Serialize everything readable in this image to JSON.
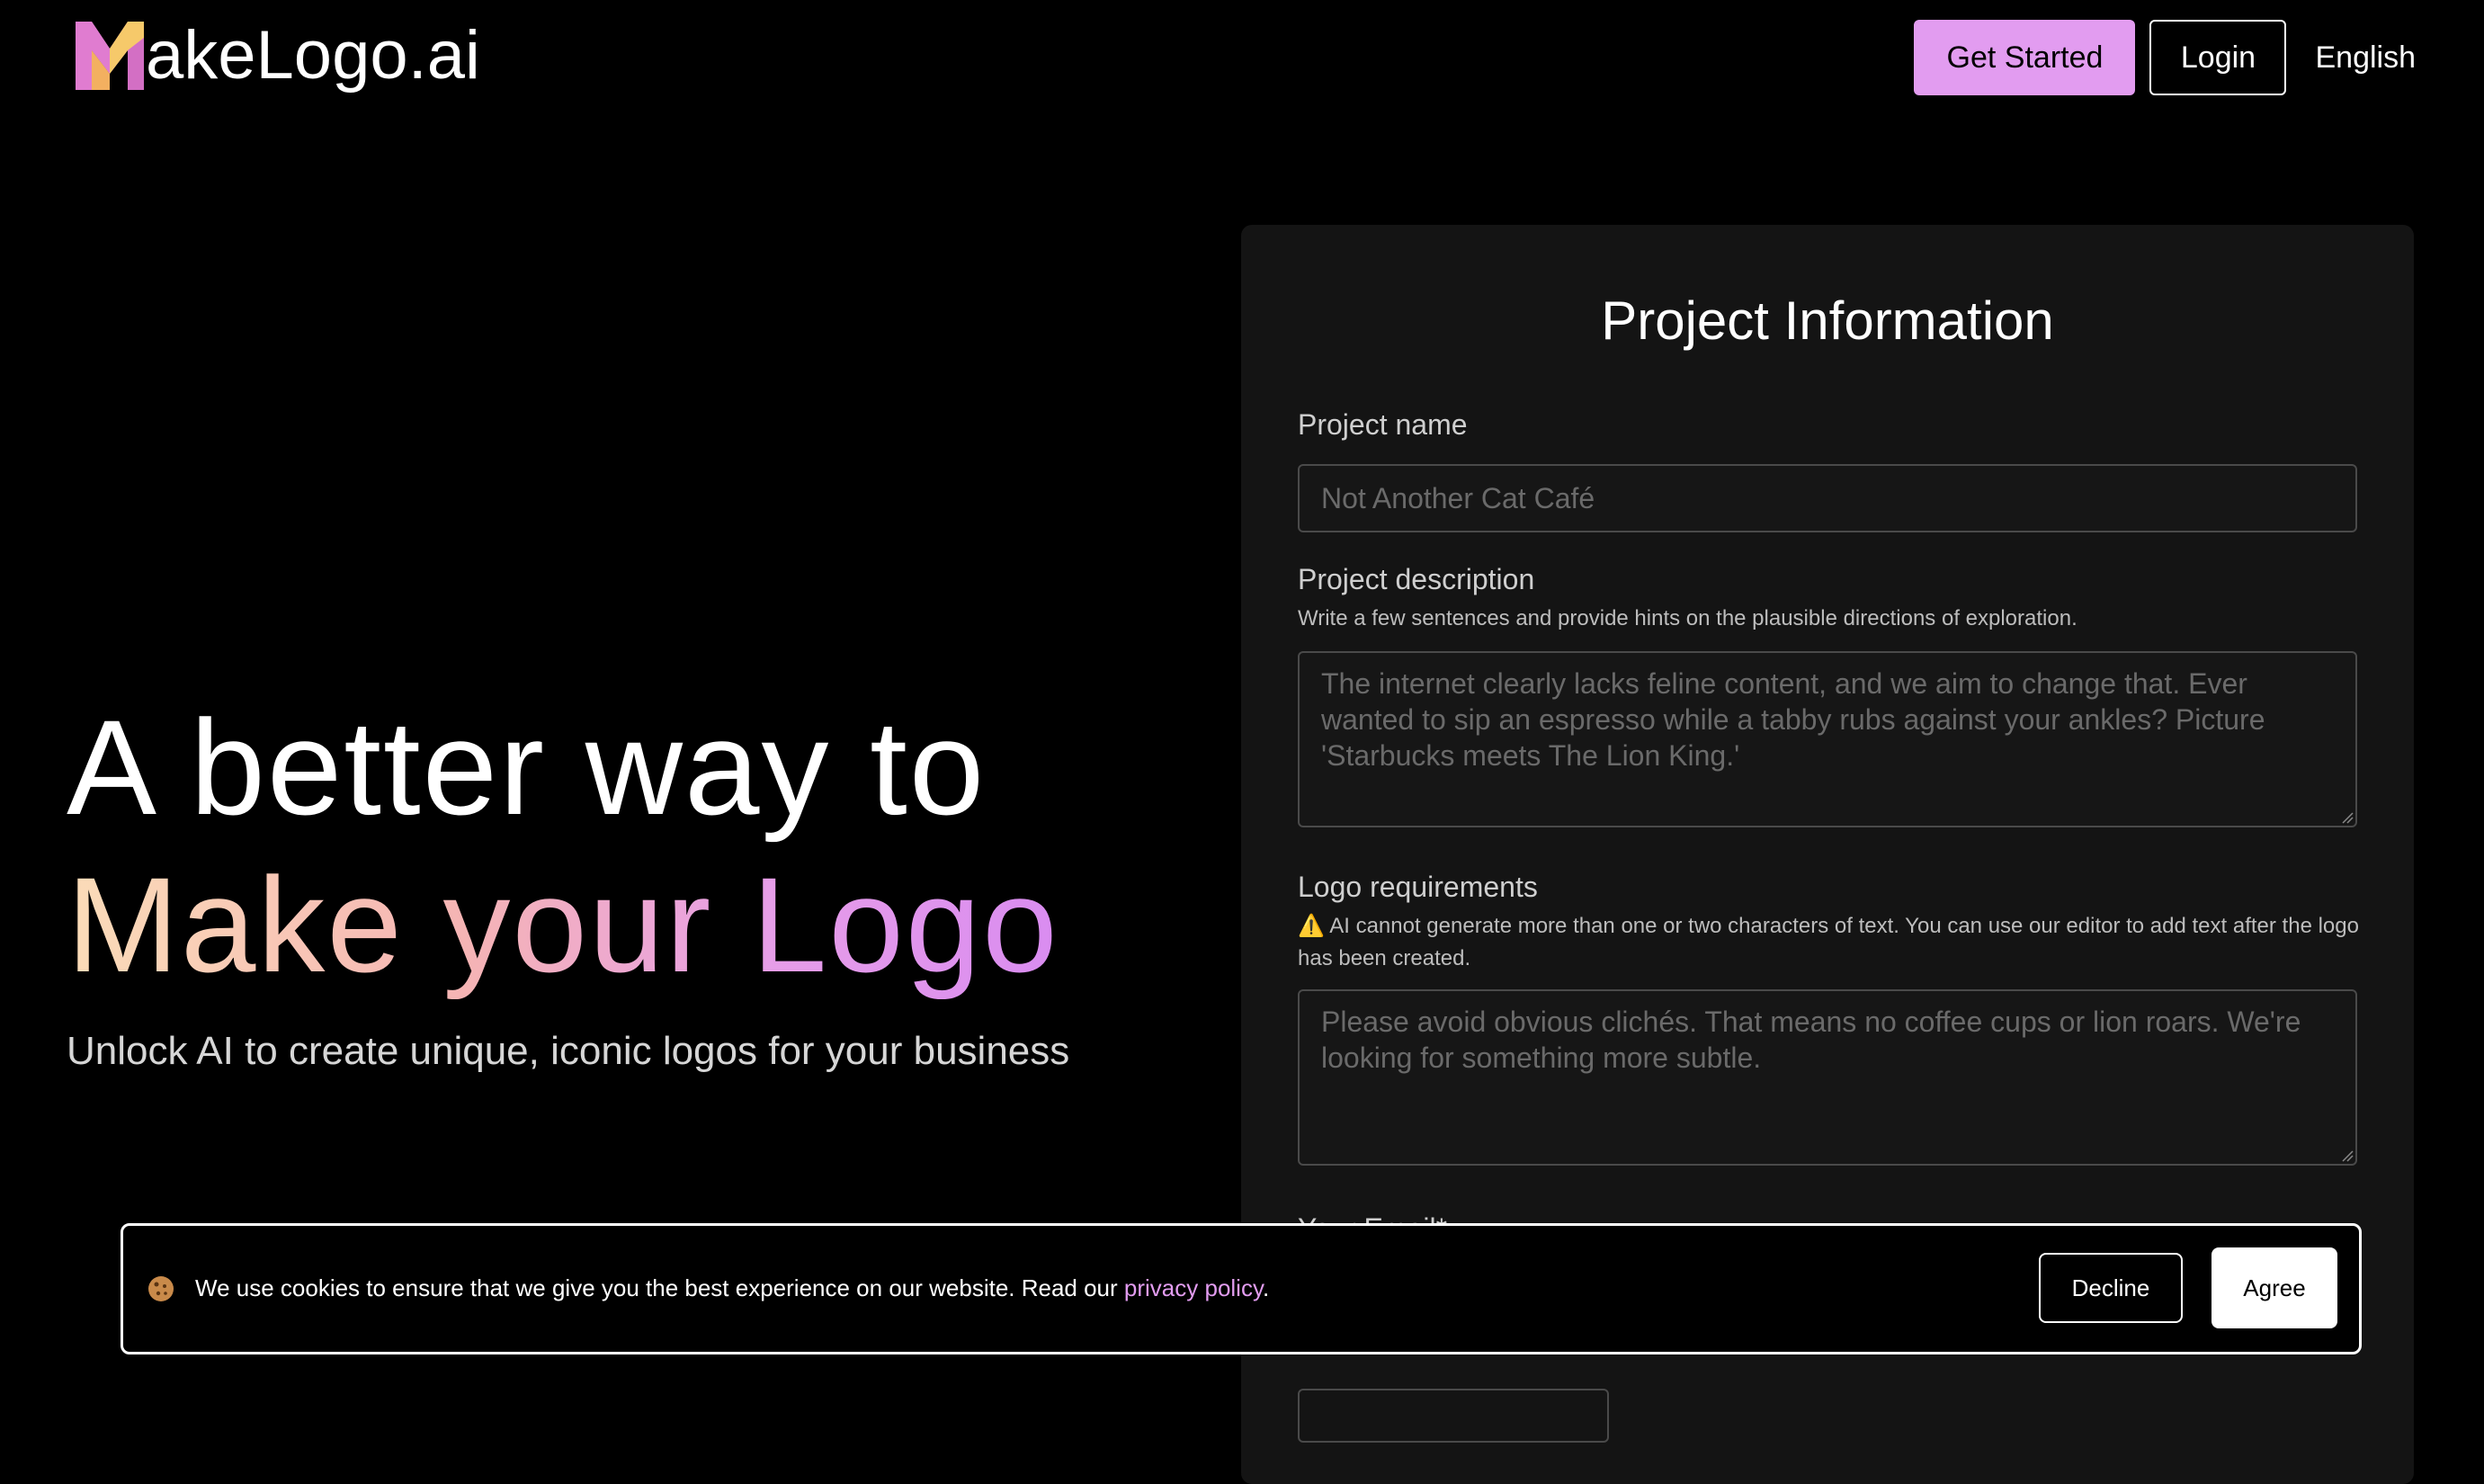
{
  "brand": {
    "name": "akeLogo.ai",
    "logo_icon": "m-letter-logo-icon",
    "colors": [
      "#f8a9c7",
      "#e29cf0",
      "#f6d36a"
    ]
  },
  "nav": {
    "get_started": "Get Started",
    "login": "Login",
    "language": "English"
  },
  "hero": {
    "line1": "A better way to",
    "line2": "Make your Logo",
    "subtitle": "Unlock AI to create unique, iconic logos for your business"
  },
  "form": {
    "title": "Project Information",
    "project_name": {
      "label": "Project name",
      "placeholder": "Not Another Cat Café"
    },
    "project_description": {
      "label": "Project description",
      "help": "Write a few sentences and provide hints on the plausible directions of exploration.",
      "placeholder": "The internet clearly lacks feline content, and we aim to change that. Ever wanted to sip an espresso while a tabby rubs against your ankles? Picture 'Starbucks meets The Lion King.'"
    },
    "logo_requirements": {
      "label": "Logo requirements",
      "warning_icon": "⚠️",
      "help": "AI cannot generate more than one or two characters of text. You can use our editor to add text after the logo has been created.",
      "placeholder": "Please avoid obvious clichés. That means no coffee cups or lion roars. We're looking for something more subtle."
    },
    "email": {
      "label": "Your Email*"
    }
  },
  "cookie_banner": {
    "icon": "cookie-icon",
    "text_before": "We use cookies to ensure that we give you the best experience on our website. Read our ",
    "link_text": "privacy policy",
    "text_after": ".",
    "decline": "Decline",
    "agree": "Agree"
  },
  "colors": {
    "accent": "#e29cf0",
    "background": "#000000",
    "panel": "#141414"
  }
}
